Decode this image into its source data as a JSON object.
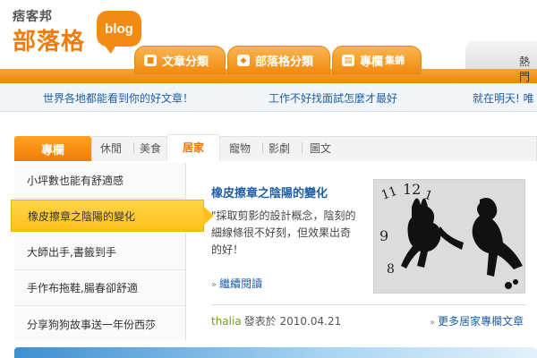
{
  "header": {
    "logo_small": "痞客邦",
    "logo_main": "部落格",
    "logo_bubble": "blog",
    "tabs": [
      {
        "label": "文章分類",
        "suffix": ""
      },
      {
        "label": "部落格分類",
        "suffix": ""
      },
      {
        "label": "專欄",
        "suffix": "集錦"
      }
    ],
    "right_text": "熱門"
  },
  "announcements": [
    "世界各地都能看到你的好文章！",
    "工作不好找面試怎麼才最好",
    "就在明天! 唯"
  ],
  "category": {
    "label": "專欄",
    "items": [
      "休閒",
      "美食",
      "居家",
      "寵物",
      "影劇",
      "圖文"
    ],
    "active": "居家"
  },
  "left_list": {
    "items": [
      "小坪數也能有舒適感",
      "橡皮擦章之陰陽的變化",
      "大師出手,書籤到手",
      "手作布拖鞋,腸春卻舒適",
      "分享狗狗故事送一年份西莎"
    ],
    "active_index": 1
  },
  "article": {
    "title": "橡皮擦章之陰陽的變化",
    "excerpt": "\"採取剪影的設計概念，陰刻的細線條很不好刻，但效果出奇的好！",
    "read_more": "繼續閱讀",
    "author": "thalia",
    "posted_label": "發表於 2010.04.21",
    "more_link": "更多居家專欄文章"
  },
  "colors": {
    "accent_orange": "#f08a10",
    "link_blue": "#1f5fa6",
    "highlight_yellow": "#ffc01b",
    "author_green": "#6f9c1a"
  }
}
